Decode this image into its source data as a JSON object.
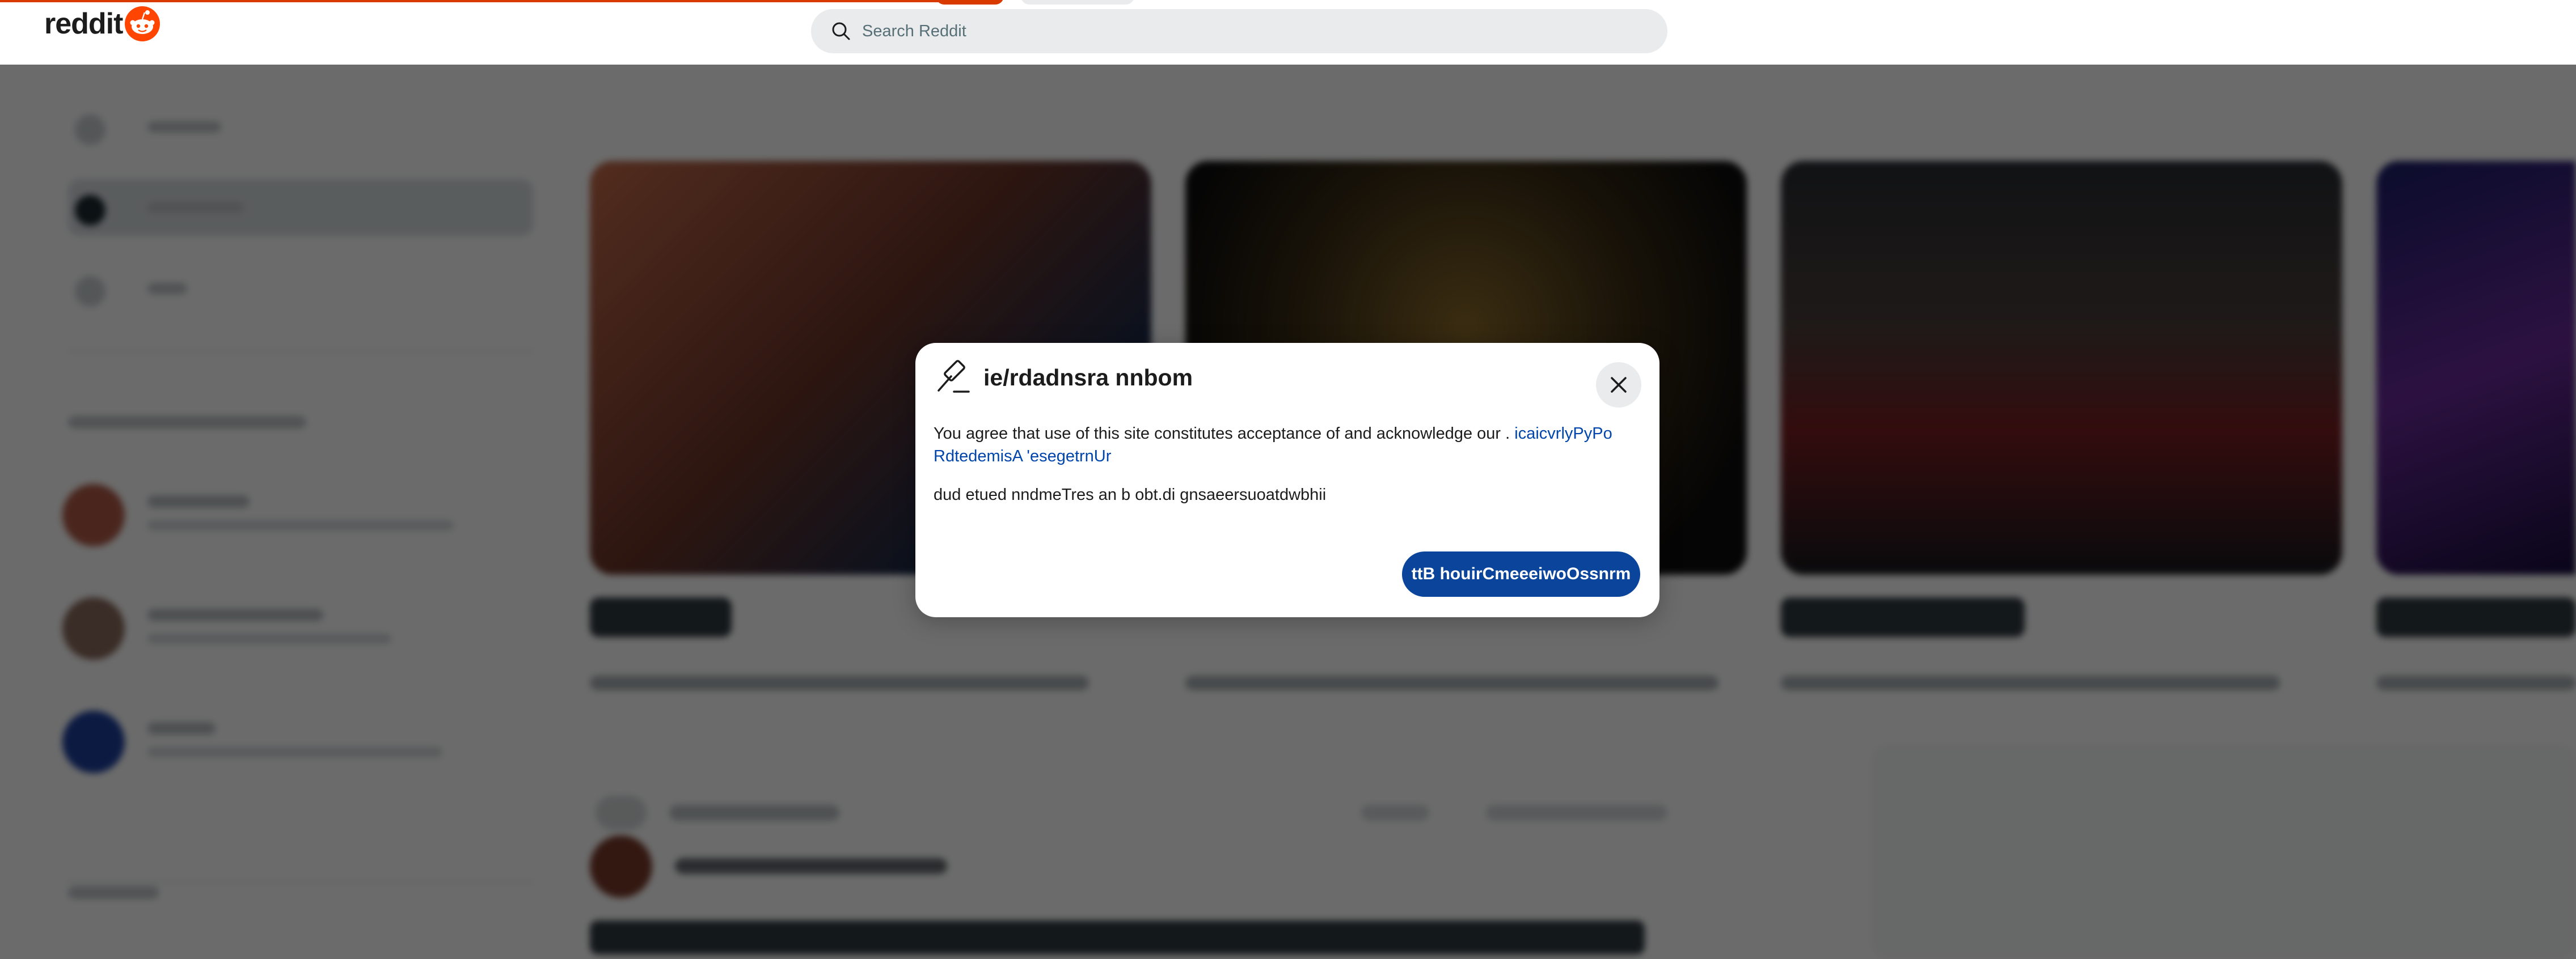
{
  "header": {
    "logo_text": "reddit",
    "search_placeholder": "Search Reddit"
  },
  "colors": {
    "brand": "#ff4500",
    "top_accent": "#d93a00",
    "link": "#0045ac",
    "primary_button": "#0a449b"
  },
  "icons": {
    "logo": "reddit-snoo-icon",
    "search": "search-icon",
    "modal": "gavel-icon",
    "close": "close-icon"
  },
  "modal": {
    "title": "ie/rdadnsra nnbom",
    "body_text": "You agree that use of this site constitutes acceptance of and acknowledge our .",
    "body_link": "icaicvrlyPyPo RdtedemisA 'esegetrnUr",
    "body_text_2": "dud etued nndmeTres an b obt.di gnsaeersuoatdwbhii",
    "primary_button": "ttB houirCmeeeiwoOssnrm"
  }
}
